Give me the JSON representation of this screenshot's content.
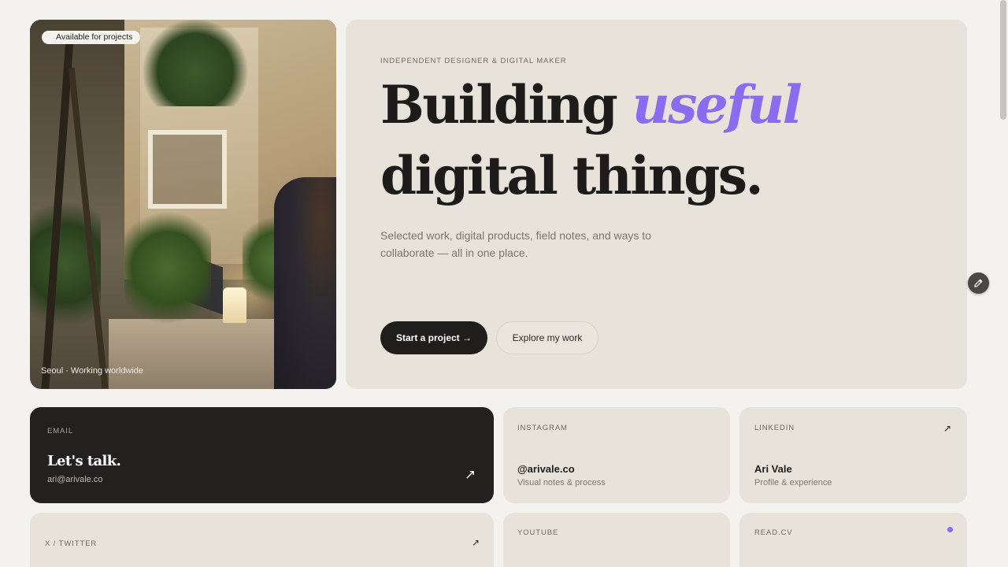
{
  "hero": {
    "badge": "Available for projects",
    "photo_caption": "Seoul · Working worldwide",
    "eyebrow": "INDEPENDENT DESIGNER & DIGITAL MAKER",
    "headline_part1": "Building",
    "headline_accent": "useful",
    "headline_part2": "digital things.",
    "lede": "Selected work, digital products, field notes, and ways to collaborate — all in one place.",
    "primary_button": "Start a project →",
    "secondary_button": "Explore my work"
  },
  "links": {
    "email": {
      "label": "EMAIL",
      "title": "Let's talk.",
      "sub": "ari@arivale.co",
      "arrow": "↗"
    },
    "instagram": {
      "label": "INSTAGRAM",
      "title": "@arivale.co",
      "sub": "Visual notes & process"
    },
    "linkedin": {
      "label": "LINKEDIN",
      "title": "Ari Vale",
      "sub": "Profile & experience",
      "arrow": "↗"
    },
    "twitter": {
      "label": "X / TWITTER",
      "arrow": "↗"
    },
    "youtube": {
      "label": "YOUTUBE"
    },
    "readcv": {
      "label": "READ.CV"
    }
  },
  "colors": {
    "accent": "#8b6cf0",
    "background": "#f4f2ee",
    "card": "#e8e3da",
    "dark": "#222120"
  },
  "icons": {
    "edit": "pencil-icon"
  }
}
